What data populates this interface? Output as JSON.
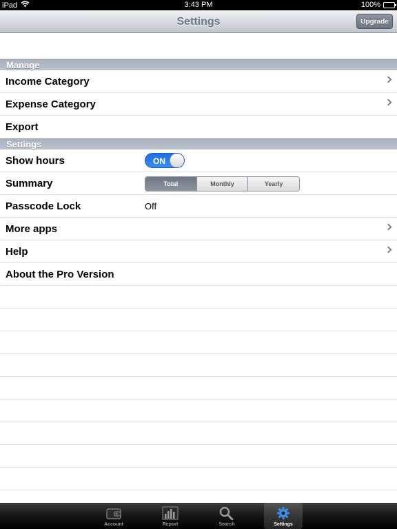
{
  "status_bar": {
    "device": "iPad",
    "time": "3:43 PM",
    "battery": "100%",
    "battery_level": 1.0
  },
  "nav": {
    "title": "Settings",
    "upgrade_label": "Upgrade"
  },
  "sections": {
    "manage": {
      "header": "Manage",
      "rows": [
        {
          "label": "Income Category"
        },
        {
          "label": "Expense Category"
        },
        {
          "label": "Export"
        }
      ]
    },
    "settings": {
      "header": "Settings",
      "show_hours": {
        "label": "Show hours",
        "toggle_text": "ON",
        "state": "on"
      },
      "summary": {
        "label": "Summary",
        "options": [
          "Total",
          "Monthly",
          "Yearly"
        ],
        "selected": "Total"
      },
      "passcode": {
        "label": "Passcode Lock",
        "value": "Off"
      },
      "more_apps": {
        "label": "More apps"
      },
      "help": {
        "label": "Help"
      },
      "about": {
        "label": "About the Pro Version"
      }
    }
  },
  "tabs": [
    {
      "label": "Account",
      "icon": "wallet-icon"
    },
    {
      "label": "Report",
      "icon": "bar-chart-icon"
    },
    {
      "label": "Search",
      "icon": "search-icon"
    },
    {
      "label": "Settings",
      "icon": "gear-icon",
      "active": true
    }
  ],
  "colors": {
    "accent": "#1f6fe0",
    "section_header": "#b0b8c4",
    "tab_active_icon": "#3b8eea"
  }
}
